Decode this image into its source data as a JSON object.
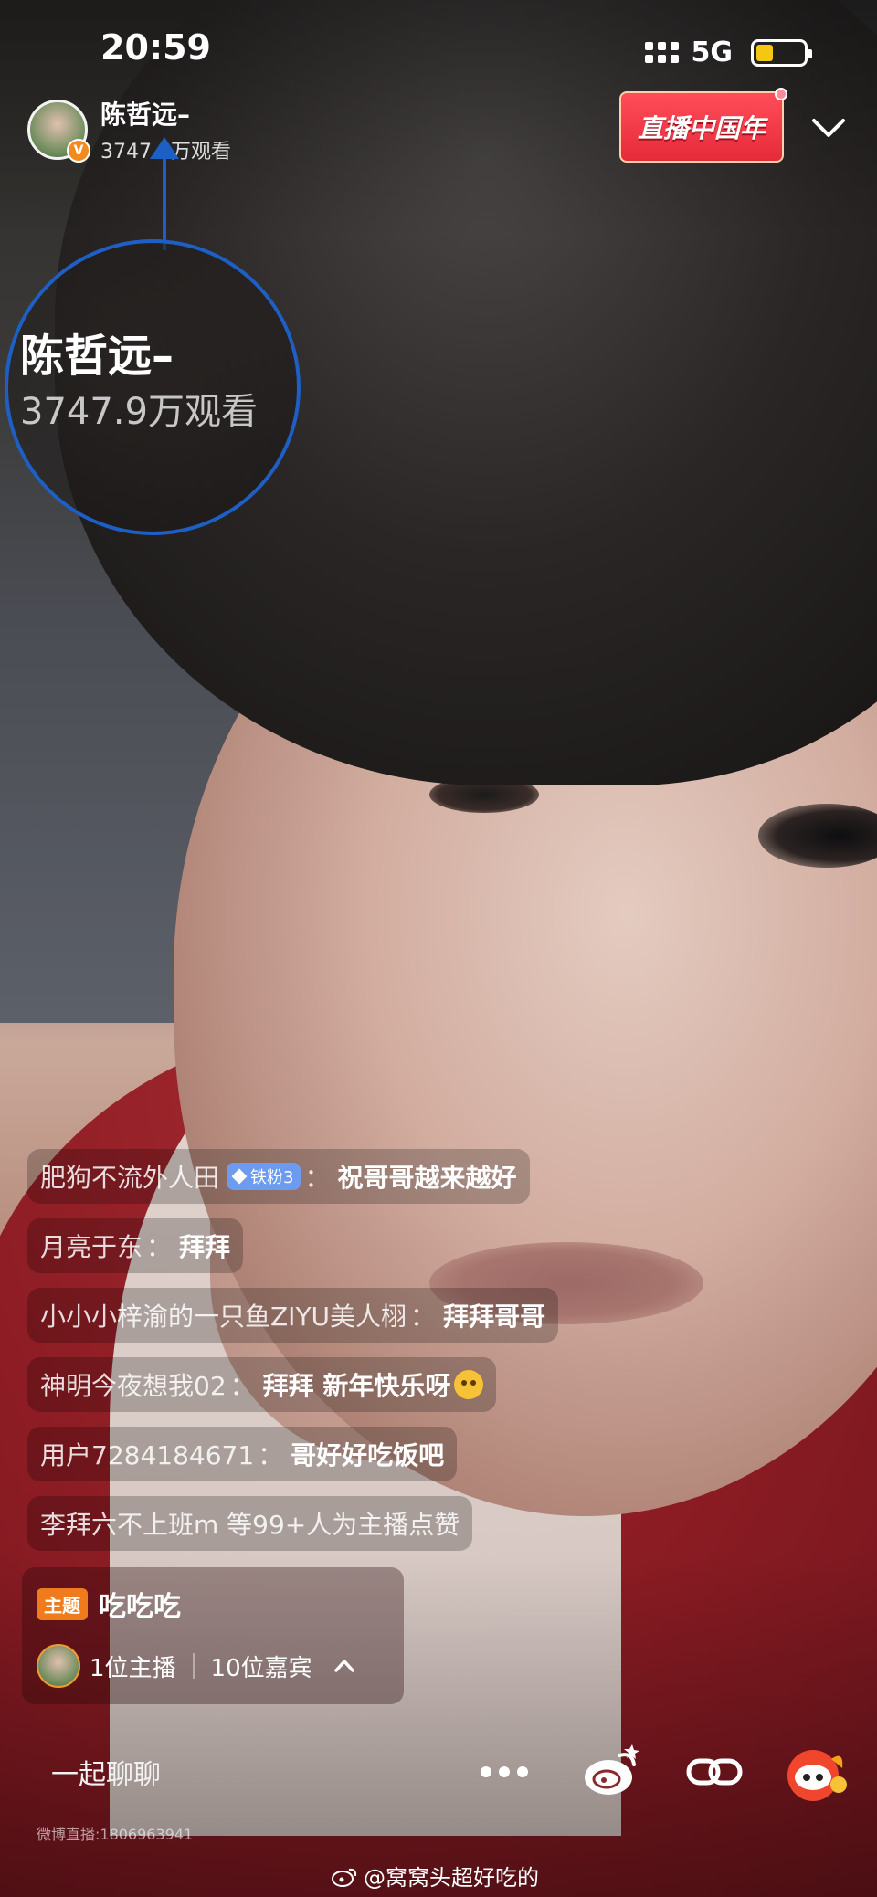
{
  "status_bar": {
    "time": "20:59",
    "network": "5G",
    "battery_level": 0.35,
    "battery_color": "#f3c712"
  },
  "streamer": {
    "name": "陈哲远–",
    "views": "3747.9万观看",
    "verified_icon": "verified-v-icon"
  },
  "festival_badge": {
    "label": "直播中国年",
    "color": "#e62a3a"
  },
  "zoom_annotation": {
    "name": "陈哲远–",
    "views": "3747.9万观看",
    "ring_color": "#1d5fc4"
  },
  "comments": [
    {
      "user": "肥狗不流外人田",
      "badge": "铁粉3",
      "text": "祝哥哥越来越好"
    },
    {
      "user": "月亮于东",
      "text": "拜拜"
    },
    {
      "user": "小小小梓渝的一只鱼ZIYU美人栩",
      "text": "拜拜哥哥"
    },
    {
      "user": "神明今夜想我02",
      "text": "拜拜 新年快乐呀",
      "emoji": "crying-laughing-emoji"
    },
    {
      "user": "用户7284184671",
      "text": "哥好好吃饭吧"
    }
  ],
  "like_notice": "李拜六不上班m 等99+人为主播点赞",
  "topic": {
    "tag": "主题",
    "title": "吃吃吃",
    "hosts": "1位主播",
    "guests": "10位嘉宾"
  },
  "bottom_bar": {
    "chat_label": "一起聊聊",
    "icons": [
      "more-icon",
      "weibo-icon",
      "link-icon",
      "gift-icon"
    ]
  },
  "room_id": "微博直播:1806963941",
  "watermark": "@窝窝头超好吃的"
}
